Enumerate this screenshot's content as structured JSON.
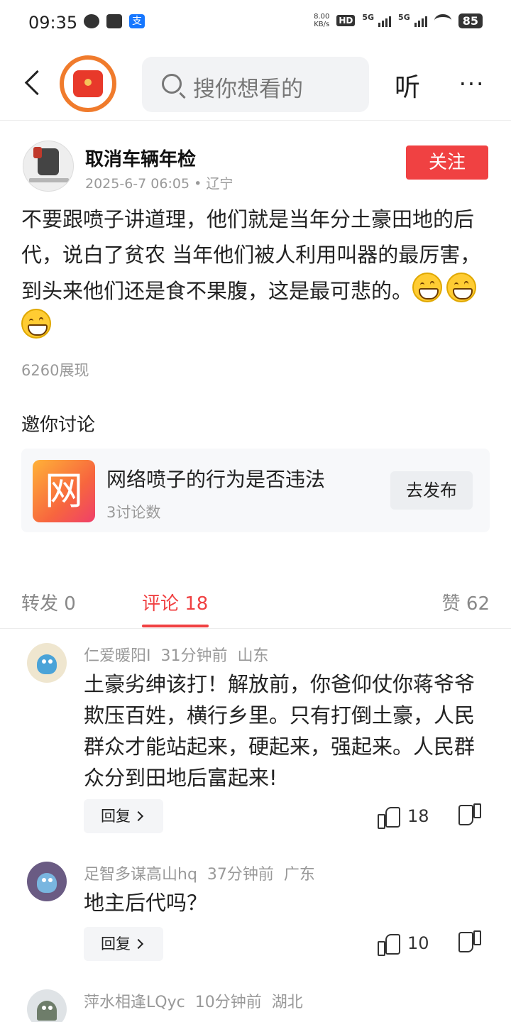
{
  "status_bar": {
    "time": "09:35",
    "net_speed": "8.00",
    "net_unit": "KB/s",
    "hd": "HD",
    "sig1": "5G",
    "sig2": "5G",
    "battery": "85",
    "pay_icon": "支"
  },
  "header": {
    "search_placeholder": "搜你想看的",
    "listen_label": "听",
    "more_label": "···"
  },
  "post": {
    "author": "取消车辆年检",
    "meta": "2025-6-7 06:05 • 辽宁",
    "follow_label": "关注",
    "text": "不要跟喷子讲道理，他们就是当年分土豪田地的后代，说白了贫农 当年他们被人利用叫器的最厉害，到头来他们还是食不果腹，这是最可悲的。",
    "views": "6260展现"
  },
  "discussion": {
    "invite_title": "邀你讨论",
    "icon_char": "网",
    "topic_title": "网络喷子的行为是否违法",
    "topic_count": "3讨论数",
    "publish_label": "去发布"
  },
  "tabs": {
    "repost": "转发 0",
    "comments": "评论 18",
    "likes": "赞 62"
  },
  "comments": [
    {
      "user": "仁爱暖阳I",
      "time": "31分钟前",
      "region": "山东",
      "text": "土豪劣绅该打！解放前，你爸仰仗你蒋爷爷欺压百姓，横行乡里。只有打倒土豪，人民群众才能站起来，硬起来，强起来。人民群众分到田地后富起来!",
      "reply_label": "回复",
      "likes": "18"
    },
    {
      "user": "足智多谋高山hq",
      "time": "37分钟前",
      "region": "广东",
      "text": "地主后代吗？",
      "reply_label": "回复",
      "likes": "10"
    },
    {
      "user": "萍水相逢LQyc",
      "time": "10分钟前",
      "region": "湖北"
    }
  ]
}
